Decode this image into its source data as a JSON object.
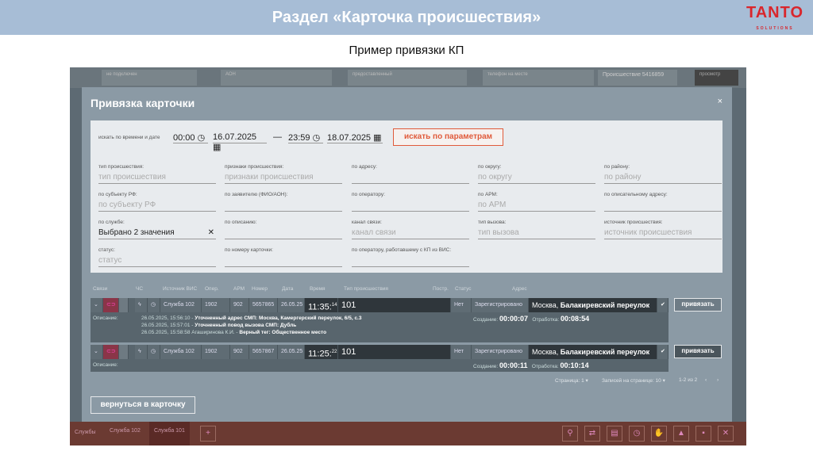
{
  "header": {
    "title": "Раздел «Карточка происшествия»",
    "logo": "TANTO",
    "logo_sub": "SOLUTIONS"
  },
  "subtitle": "Пример привязки КП",
  "background": {
    "topbar": [
      "не подключен",
      "АОН",
      "предоставленный",
      "телефон на месте",
      "Происшествие 5416859",
      "просмотр"
    ],
    "bottombar": {
      "label": "Службы",
      "tabs": [
        "Служба 102",
        "Служба 101"
      ]
    }
  },
  "modal": {
    "title": "Привязка карточки",
    "close": "×",
    "search_by_time": "искать по времени и дате",
    "time_from": "00:00",
    "date_from": "16.07.2025",
    "dash": "—",
    "time_to": "23:59",
    "date_to": "18.07.2025",
    "search_button": "искать по параметрам",
    "fields": [
      {
        "label": "тип происшествия:",
        "value": "тип происшествия",
        "filled": false
      },
      {
        "label": "признаки происшествия:",
        "value": "признаки происшествия",
        "filled": false
      },
      {
        "label": "по адресу:",
        "value": "",
        "filled": false
      },
      {
        "label": "по округу:",
        "value": "по округу",
        "filled": false
      },
      {
        "label": "по району:",
        "value": "по району",
        "filled": false
      },
      {
        "label": "по субъекту РФ:",
        "value": "по субъекту РФ",
        "filled": false
      },
      {
        "label": "по заявителю (ФИО/АОН):",
        "value": "",
        "filled": false
      },
      {
        "label": "по оператору:",
        "value": "",
        "filled": false
      },
      {
        "label": "по АРМ:",
        "value": "по АРМ",
        "filled": false
      },
      {
        "label": "по описательному адресу:",
        "value": "",
        "filled": false
      },
      {
        "label": "по службе:",
        "value": "Выбрано 2 значения",
        "filled": true
      },
      {
        "label": "по описанию:",
        "value": "",
        "filled": false
      },
      {
        "label": "канал связи:",
        "value": "канал связи",
        "filled": false
      },
      {
        "label": "тип вызова:",
        "value": "тип вызова",
        "filled": false
      },
      {
        "label": "источник происшествия:",
        "value": "источник происшествия",
        "filled": false
      },
      {
        "label": "статус:",
        "value": "статус",
        "filled": false
      },
      {
        "label": "по номеру карточки:",
        "value": "",
        "filled": false
      },
      {
        "label": "по оператору, работавшему с КП из ВИС:",
        "value": "",
        "filled": false
      }
    ],
    "table_headers": [
      "Связи",
      "ЧС",
      "Источник ВИС",
      "Опер.",
      "АРМ",
      "Номер",
      "Дата",
      "Время",
      "Тип происшествия",
      "Постр.",
      "Статус",
      "Адрес"
    ],
    "rows": [
      {
        "service": "Служба 102",
        "oper": "1902",
        "arm": "902",
        "number": "5657865",
        "date": "26.05.25",
        "time": "11:35:",
        "sec": "14",
        "type": "101",
        "postr": "Нет",
        "status": "Зарегистрировано",
        "city": "Москва, ",
        "street": "Балакиревский переулок",
        "desc_label": "Описание:",
        "creation_label": "Создание:",
        "creation": "00:00:07",
        "work_label": "Отработка:",
        "work": "00:08:54",
        "bind": "привязать",
        "desc": [
          {
            "ts": "26.05.2025, 15:56:10 - ",
            "text": "Уточненный адрес СМП: Москва, Камергерский переулок, 6/5, с.3"
          },
          {
            "ts": "26.05.2025, 15:57:01 - ",
            "text": "Уточненный повод вызова СМП: Дубль"
          },
          {
            "ts": "26.05.2025, 15:58:58 Агаширинова К.И. - ",
            "text": "Верный тег: Общественное место"
          }
        ]
      },
      {
        "service": "Служба 102",
        "oper": "1902",
        "arm": "902",
        "number": "5657867",
        "date": "26.05.25",
        "time": "11:25:",
        "sec": "22",
        "type": "101",
        "postr": "Нет",
        "status": "Зарегистрировано",
        "city": "Москва, ",
        "street": "Балакиревский переулок",
        "desc_label": "Описание:",
        "creation_label": "Создание:",
        "creation": "00:00:11",
        "work_label": "Отработка:",
        "work": "00:10:14",
        "bind": "привязать",
        "desc": []
      }
    ],
    "pager": {
      "page": "Страница: 1",
      "per_page": "Записей на странице: 10",
      "range": "1-2 из 2"
    },
    "back_button": "вернуться в карточку"
  }
}
